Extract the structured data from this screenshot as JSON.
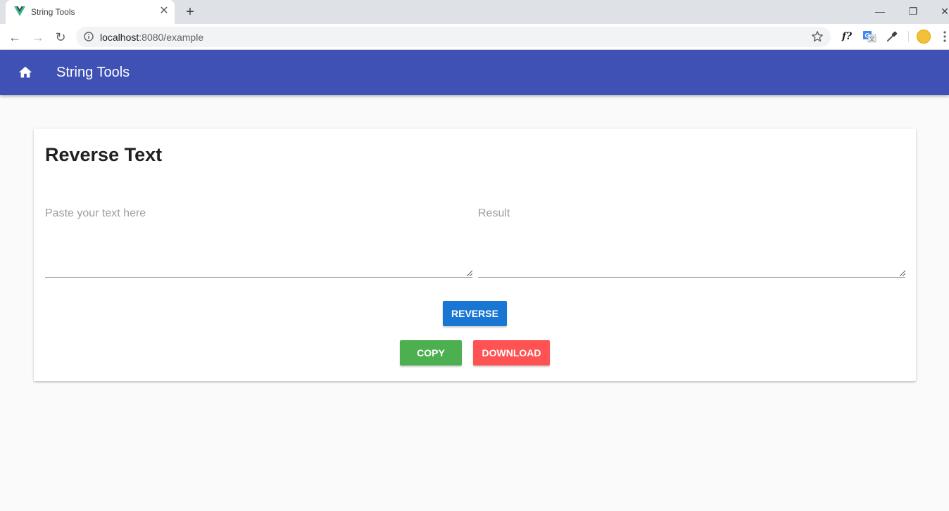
{
  "browser": {
    "tab_title": "String Tools",
    "url_host": "localhost",
    "url_path": ":8080/example",
    "tab_close": "✕",
    "new_tab": "+",
    "minimize": "—",
    "restore": "❐",
    "close_window": "✕",
    "back": "←",
    "forward": "→",
    "reload": "↻",
    "ext_formula": "f?"
  },
  "appbar": {
    "title": "String Tools",
    "color": "#3f51b5"
  },
  "card": {
    "title": "Reverse Text",
    "input_placeholder": "Paste your text here",
    "result_placeholder": "Result",
    "reverse_label": "Reverse",
    "copy_label": "Copy",
    "download_label": "Download"
  },
  "colors": {
    "reverse": "#1976d2",
    "copy": "#4caf50",
    "download": "#ff5252"
  }
}
